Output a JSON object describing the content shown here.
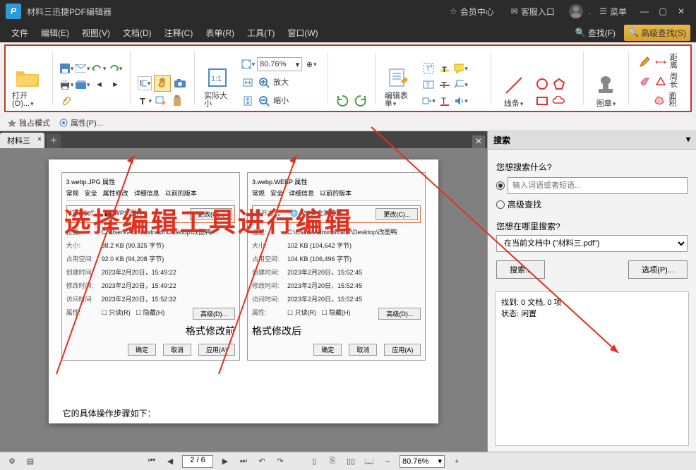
{
  "titlebar": {
    "app_title": "材料三迅捷PDF编辑器",
    "member_center": "会员中心",
    "service_entry": "客服入口",
    "menu_label": "菜单"
  },
  "menubar": {
    "items": [
      "文件",
      "编辑(E)",
      "视图(V)",
      "文档(D)",
      "注释(C)",
      "表单(R)",
      "工具(T)",
      "窗口(W)"
    ],
    "find": "查找(F)",
    "adv_find": "高级查找(S)"
  },
  "ribbon": {
    "open": "打开(O)...",
    "actual_size": "实际大小",
    "zoom_value": "80.76%",
    "zoom_in": "放大",
    "zoom_out": "缩小",
    "edit_form": "编辑表单",
    "lines": "线条",
    "stamp": "图章",
    "distance": "距离",
    "perimeter": "周长",
    "area": "面积"
  },
  "subbar": {
    "exclusive": "独占模式",
    "props": "属性(P)..."
  },
  "tabs": {
    "doc1": "材料三"
  },
  "overlay": "选择编辑工具进行编辑",
  "prop_before": {
    "title": "3.webp.JPG 属性",
    "tabs": [
      "常规",
      "安全",
      "属性修改",
      "详细信息",
      "以前的版本"
    ],
    "open_with_k": "打开方式:",
    "open_with_v": "WPS 图片",
    "change": "更改(C)...",
    "loc_k": "位置:",
    "loc_v": "C:\\Users\\Administrator\\Desktop\\改图鸭",
    "size_k": "大小:",
    "size_v": "88.2 KB (90,325 字节)",
    "disk_k": "占用空间:",
    "disk_v": "92.0 KB (94,208 字节)",
    "ctime_k": "创建时间:",
    "ctime_v": "2023年2月20日，15:49:22",
    "mtime_k": "修改时间:",
    "mtime_v": "2023年2月20日，15:49:22",
    "atime_k": "访问时间:",
    "atime_v": "2023年2月20日，15:52:32",
    "attr_k": "属性:",
    "readonly": "只读(R)",
    "hidden": "隐藏(H)",
    "adv": "高级(D)...",
    "caption": "格式修改前",
    "ok": "确定",
    "cancel": "取消",
    "apply": "应用(A)"
  },
  "prop_after": {
    "title": "3.webp.WEBP 属性",
    "tabs": [
      "常规",
      "安全",
      "详细信息",
      "以前的版本"
    ],
    "open_with_v": "360安全浏览器",
    "size_v": "102 KB (104,642 字节)",
    "disk_v": "104 KB (106,496 字节)",
    "ctime_v": "2023年2月20日，15:52:45",
    "mtime_v": "2023年2月20日，15:52:45",
    "atime_v": "2023年2月20日，15:52:45",
    "caption": "格式修改后"
  },
  "page_footer": "它的具体操作步骤如下：",
  "search": {
    "title": "搜索",
    "what_label": "您想搜索什么?",
    "placeholder": "输入词语或者短语...",
    "adv_label": "高级查找",
    "where_label": "您想在哪里搜索?",
    "scope": "在当前文档中 (\"材料三.pdf\")",
    "search_btn": "搜索...",
    "options_btn": "选项(P)...",
    "found_k": "找到:",
    "found_v": "0 文档, 0 项",
    "status_k": "状态:",
    "status_v": "闲置"
  },
  "statusbar": {
    "page": "2",
    "total": "6",
    "zoom": "80.76%"
  }
}
